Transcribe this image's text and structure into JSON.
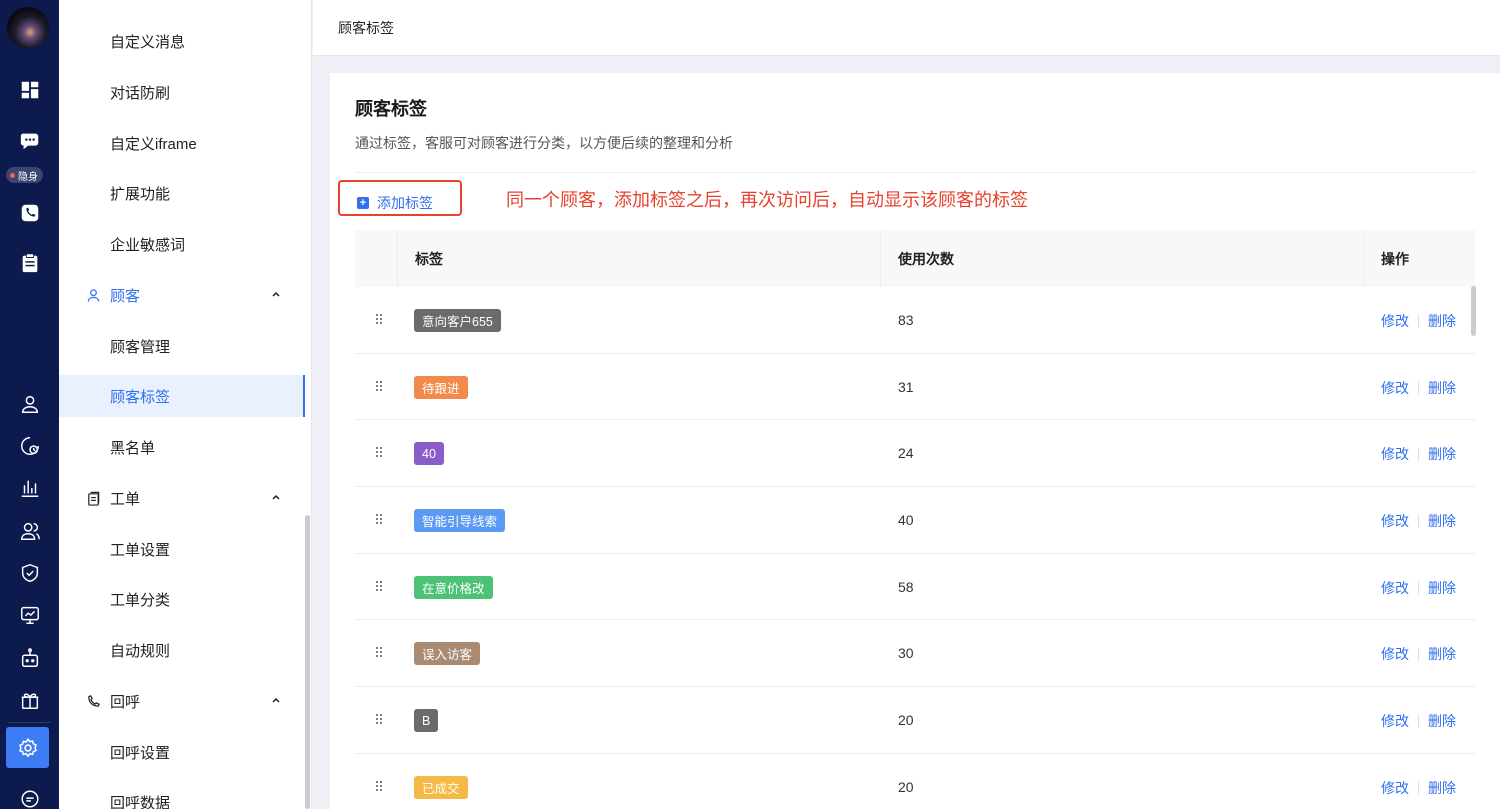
{
  "rail": {
    "hidden_label": "隐身",
    "icons": [
      "avatar",
      "dashboard-icon",
      "chat-icon",
      "phone-icon",
      "clipboard-icon",
      "user-icon",
      "history-icon",
      "chart-icon",
      "team-icon",
      "shield-icon",
      "monitor-icon",
      "robot-icon",
      "gift-icon",
      "gear-icon",
      "chat-bubble-icon"
    ]
  },
  "sidebar": {
    "items_top": [
      "自定义消息",
      "对话防刷",
      "自定义iframe",
      "扩展功能",
      "企业敏感词"
    ],
    "group_customer": "顾客",
    "customer_items": [
      "顾客管理",
      "顾客标签",
      "黑名单"
    ],
    "group_ticket": "工单",
    "ticket_items": [
      "工单设置",
      "工单分类",
      "自动规则"
    ],
    "group_callback": "回呼",
    "callback_items": [
      "回呼设置",
      "回呼数据"
    ]
  },
  "header": {
    "breadcrumb": "顾客标签"
  },
  "main": {
    "title": "顾客标签",
    "description": "通过标签，客服可对顾客进行分类，以方便后续的整理和分析",
    "add_button": "添加标签",
    "annotation": "同一个顾客，添加标签之后，再次访问后，自动显示该顾客的标签",
    "columns": [
      "标签",
      "使用次数",
      "操作"
    ],
    "edit_label": "修改",
    "delete_label": "删除",
    "rows": [
      {
        "tag": "意向客户655",
        "color": "#6b6b6b",
        "count": "83"
      },
      {
        "tag": "待跟进",
        "color": "#f28a4b",
        "count": "31"
      },
      {
        "tag": "40",
        "color": "#8a5dc9",
        "count": "24"
      },
      {
        "tag": "智能引导线索",
        "color": "#5b9af2",
        "count": "40"
      },
      {
        "tag": "在意价格改",
        "color": "#4cc277",
        "count": "58"
      },
      {
        "tag": "误入访客",
        "color": "#a98a73",
        "count": "30"
      },
      {
        "tag": "B",
        "color": "#6b6b6b",
        "count": "20"
      },
      {
        "tag": "已成交",
        "color": "#f5b946",
        "count": "20"
      }
    ]
  }
}
